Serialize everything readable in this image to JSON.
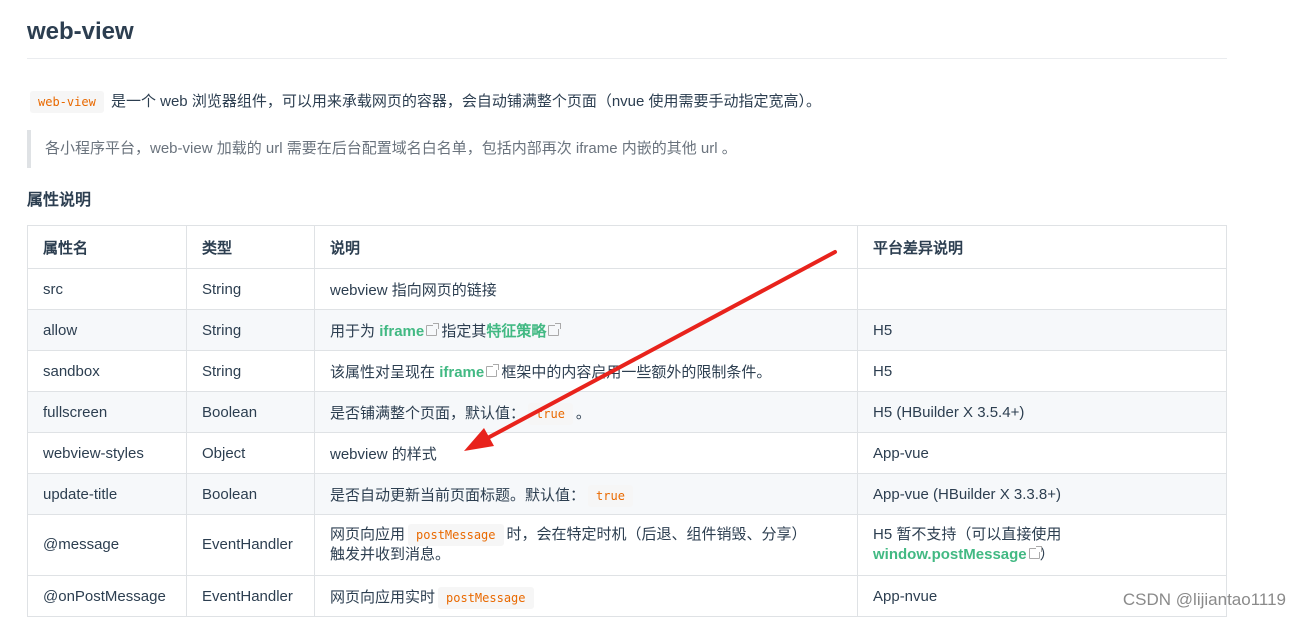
{
  "header": {
    "title": "web-view"
  },
  "intro": {
    "code": "web-view",
    "text": "是一个 web 浏览器组件，可以用来承载网页的容器，会自动铺满整个页面（nvue 使用需要手动指定宽高）。"
  },
  "note": {
    "text": "各小程序平台，web-view 加载的 url 需要在后台配置域名白名单，包括内部再次 iframe 内嵌的其他 url 。"
  },
  "section": {
    "title": "属性说明"
  },
  "table": {
    "headers": [
      "属性名",
      "类型",
      "说明",
      "平台差异说明"
    ],
    "rows": {
      "src": {
        "name": "src",
        "type": "String",
        "desc": "webview 指向网页的链接",
        "platform": ""
      },
      "allow": {
        "name": "allow",
        "type": "String",
        "desc_a": "用于为",
        "link1": "iframe",
        "desc_b": "指定其",
        "link2": "特征策略",
        "platform": "H5"
      },
      "sandbox": {
        "name": "sandbox",
        "type": "String",
        "desc_a": "该属性对呈现在",
        "link1": "iframe",
        "desc_b": "框架中的内容启用一些额外的限制条件。",
        "platform": "H5"
      },
      "fullscreen": {
        "name": "fullscreen",
        "type": "Boolean",
        "desc_a": "是否铺满整个页面，默认值：",
        "code": "true",
        "desc_b": "。",
        "platform": "H5 (HBuilder X 3.5.4+)"
      },
      "styles": {
        "name": "webview-styles",
        "type": "Object",
        "desc": "webview 的样式",
        "platform": "App-vue"
      },
      "update": {
        "name": "update-title",
        "type": "Boolean",
        "desc_a": "是否自动更新当前页面标题。默认值：",
        "code": "true",
        "platform": "App-vue (HBuilder X 3.3.8+)"
      },
      "message": {
        "name": "@message",
        "type": "EventHandler",
        "desc_a": "网页向应用",
        "code": "postMessage",
        "desc_b": "时，会在特定时机（后退、组件销毁、分享）",
        "desc_c": "触发并收到消息。",
        "platform_a": "H5 暂不支持（可以直接使用",
        "platform_link": "window.postMessage",
        "platform_b": "）"
      },
      "onpost": {
        "name": "@onPostMessage",
        "type": "EventHandler",
        "desc_a": "网页向应用实时",
        "code": "postMessage",
        "platform": "App-nvue"
      }
    }
  },
  "watermark": {
    "text": "CSDN @lijiantao1119"
  },
  "colors": {
    "link": "#42b983",
    "code": "#e96900",
    "arrow": "#e8231c"
  },
  "icons": [
    "external-link-icon",
    "red-arrow"
  ]
}
